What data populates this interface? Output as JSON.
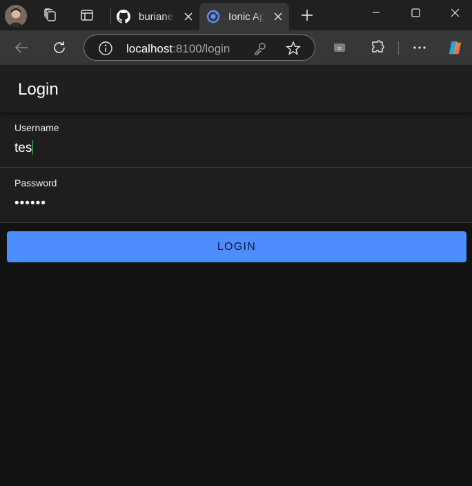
{
  "browser": {
    "tabs": [
      {
        "title": "buriane/",
        "favicon": "github-icon"
      },
      {
        "title": "Ionic App",
        "favicon": "ionic-icon",
        "active": true
      }
    ],
    "address": {
      "host": "localhost",
      "rest": ":8100/login"
    }
  },
  "page": {
    "header_title": "Login",
    "username": {
      "label": "Username",
      "value": "tes"
    },
    "password": {
      "label": "Password",
      "value": "••••••"
    },
    "login_button": "LOGIN"
  },
  "colors": {
    "accent": "#4d8dff",
    "page_bg": "#121212",
    "header_bg": "#1f1f1f",
    "caret": "#44c36a"
  }
}
